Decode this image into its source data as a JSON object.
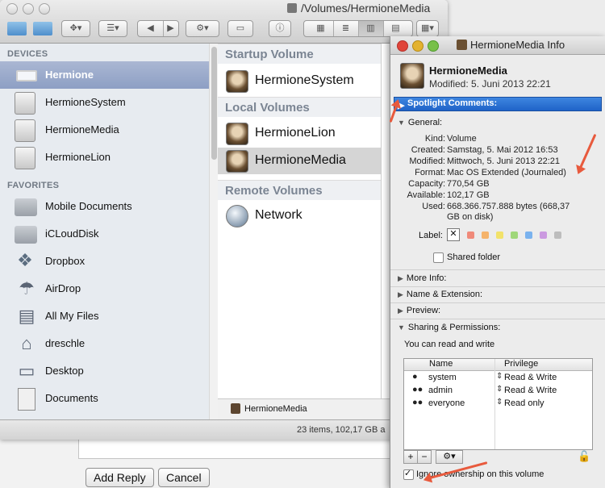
{
  "finder": {
    "path_title": "/Volumes/HermioneMedia",
    "sidebar": {
      "devices_heading": "DEVICES",
      "devices": [
        {
          "label": "Hermione",
          "icon": "laptop-icon",
          "selected": true
        },
        {
          "label": "HermioneSystem",
          "icon": "disk-icon"
        },
        {
          "label": "HermioneMedia",
          "icon": "disk-icon"
        },
        {
          "label": "HermioneLion",
          "icon": "disk-icon"
        }
      ],
      "favorites_heading": "FAVORITES",
      "favorites": [
        {
          "label": "Mobile Documents",
          "icon": "folder-icon"
        },
        {
          "label": "iCLoudDisk",
          "icon": "folder-icon"
        },
        {
          "label": "Dropbox",
          "icon": "dropbox-icon"
        },
        {
          "label": "AirDrop",
          "icon": "airdrop-icon"
        },
        {
          "label": "All My Files",
          "icon": "all-files-icon"
        },
        {
          "label": "dreschle",
          "icon": "home-icon"
        },
        {
          "label": "Desktop",
          "icon": "desktop-icon"
        },
        {
          "label": "Documents",
          "icon": "documents-icon"
        }
      ]
    },
    "column": {
      "startup_heading": "Startup Volume",
      "startup": [
        "HermioneSystem"
      ],
      "local_heading": "Local Volumes",
      "local": [
        "HermioneLion",
        "HermioneMedia"
      ],
      "remote_heading": "Remote Volumes",
      "remote": [
        "Network"
      ]
    },
    "pathbar_label": "HermioneMedia",
    "status": "23 items, 102,17 GB a"
  },
  "info": {
    "window_title": "HermioneMedia Info",
    "name": "HermioneMedia",
    "modified": "Modified: 5. Juni 2013 22:21",
    "spotlight_label": "Spotlight Comments:",
    "general_label": "General:",
    "general": {
      "kind_k": "Kind:",
      "kind_v": "Volume",
      "created_k": "Created:",
      "created_v": "Samstag, 5. Mai 2012 16:53",
      "modified_k": "Modified:",
      "modified_v": "Mittwoch, 5. Juni 2013 22:21",
      "format_k": "Format:",
      "format_v": "Mac OS Extended (Journaled)",
      "capacity_k": "Capacity:",
      "capacity_v": "770,54 GB",
      "available_k": "Available:",
      "available_v": "102,17 GB",
      "used_k": "Used:",
      "used_v1": "668.366.757.888 bytes (668,37",
      "used_v2": "GB on disk)",
      "label_k": "Label:",
      "label_colors": [
        "#f08a7a",
        "#f5b36b",
        "#f2e26a",
        "#9fd77a",
        "#7ab2ee",
        "#cb9ae0",
        "#bdbdbd"
      ],
      "shared_folder": "Shared folder",
      "shared_checked": false
    },
    "more_info": "More Info:",
    "name_extension": "Name & Extension:",
    "preview": "Preview:",
    "sharing": "Sharing & Permissions:",
    "sharing_note": "You can read and write",
    "perm_headers": {
      "name": "Name",
      "privilege": "Privilege"
    },
    "permissions": [
      {
        "name": "system",
        "privilege": "Read & Write",
        "icon": "user-icon"
      },
      {
        "name": "admin",
        "privilege": "Read & Write",
        "icon": "group-icon"
      },
      {
        "name": "everyone",
        "privilege": "Read only",
        "icon": "group-icon"
      }
    ],
    "ignore_ownership": "Ignore ownership on this volume",
    "ignore_checked": true,
    "add_symbol": "+",
    "remove_symbol": "−",
    "action_symbol": "⚙▾"
  },
  "background": {
    "add_reply": "Add Reply",
    "cancel": "Cancel"
  },
  "annotation_color": "#e85a3d"
}
